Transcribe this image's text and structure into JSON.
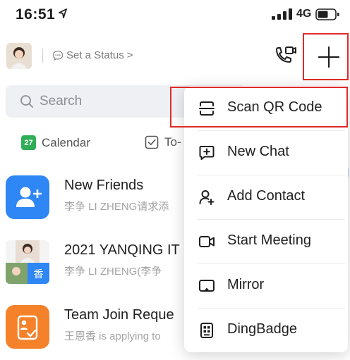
{
  "status_bar": {
    "time": "16:51",
    "network": "4G"
  },
  "header": {
    "status_label": "Set a Status",
    "status_chevron": ">"
  },
  "search": {
    "placeholder": "Search"
  },
  "shortcuts": [
    {
      "label": "Calendar",
      "icon_text": "27"
    },
    {
      "label": "To-"
    }
  ],
  "list": [
    {
      "title": "New Friends",
      "subtitle": "李争 LI ZHENG请求添"
    },
    {
      "title": "2021 YANQING IT",
      "subtitle": "李争 LI ZHENG(李争",
      "badge": "香"
    },
    {
      "title": "Team Join Reque",
      "subtitle": "王恩香 is applying to"
    }
  ],
  "menu": {
    "items": [
      {
        "label": "Scan QR Code"
      },
      {
        "label": "New Chat"
      },
      {
        "label": "Add Contact"
      },
      {
        "label": "Start Meeting"
      },
      {
        "label": "Mirror"
      },
      {
        "label": "DingBadge"
      }
    ]
  },
  "colors": {
    "accent_blue": "#2f86f5",
    "highlight_red": "#e02a2a",
    "calendar_green": "#2fae57",
    "team_orange": "#f5822b"
  }
}
